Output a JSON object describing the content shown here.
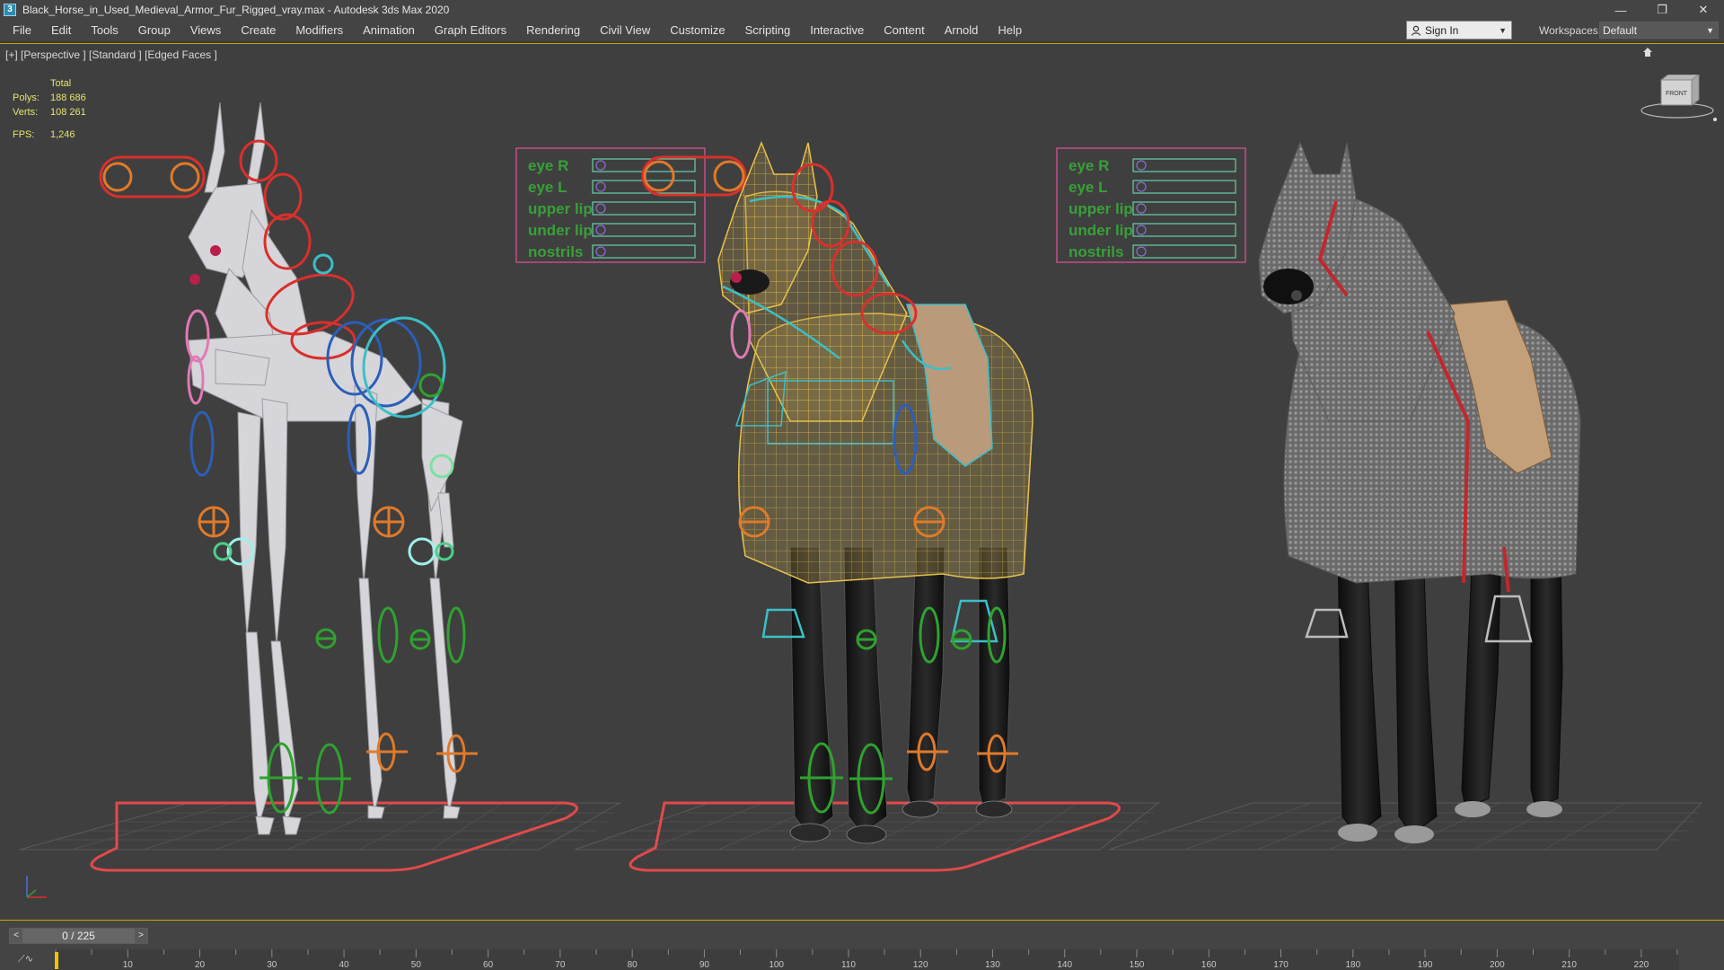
{
  "window": {
    "title": "Black_Horse_in_Used_Medieval_Armor_Fur_Rigged_vray.max - Autodesk 3ds Max 2020",
    "minimize_glyph": "—",
    "restore_glyph": "❐",
    "close_glyph": "✕"
  },
  "menu": {
    "items": [
      "File",
      "Edit",
      "Tools",
      "Group",
      "Views",
      "Create",
      "Modifiers",
      "Animation",
      "Graph Editors",
      "Rendering",
      "Civil View",
      "Customize",
      "Scripting",
      "Interactive",
      "Content",
      "Arnold",
      "Help"
    ]
  },
  "signin": {
    "label": "Sign In"
  },
  "workspace": {
    "label": "Workspaces:",
    "value": "Default"
  },
  "viewport": {
    "label": "[+] [Perspective ] [Standard ] [Edged Faces ]",
    "stats": {
      "header": "Total",
      "polys_label": "Polys:",
      "polys_value": "188 686",
      "verts_label": "Verts:",
      "verts_value": "108 261",
      "fps_label": "FPS:",
      "fps_value": "1,246"
    },
    "viewcube_label": "FRONT"
  },
  "face_panels": {
    "labels": [
      "eye R",
      "eye L",
      "upper lip",
      "under lip",
      "nostrils"
    ]
  },
  "timeline": {
    "frame_readout": "0 / 225",
    "prev_glyph": "<",
    "next_glyph": ">",
    "ticks": [
      "10",
      "20",
      "30",
      "40",
      "50",
      "60",
      "70",
      "80",
      "90",
      "100",
      "110",
      "120",
      "130",
      "140",
      "150",
      "160",
      "170",
      "180",
      "190",
      "200",
      "210",
      "220"
    ]
  },
  "colors": {
    "viewport_bg": "#3f3f3f",
    "accent_border": "#c7a800",
    "stats_text": "#e7e56e",
    "control_red": "#d9302c",
    "control_orange": "#e07a2a",
    "control_green": "#2fa22f",
    "control_blue": "#2b5fb8",
    "control_cyan": "#3bbfc8",
    "control_pink": "#e07ab4",
    "wire_yellow": "#e8c24a",
    "panel_pink": "#c24f8a",
    "panel_text_green": "#38a038"
  }
}
